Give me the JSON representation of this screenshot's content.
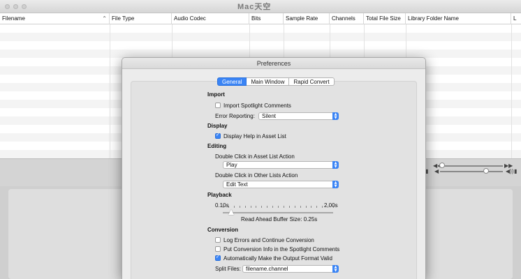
{
  "watermark": "Mac天空",
  "table": {
    "columns": [
      {
        "label": "Filename"
      },
      {
        "label": "File Type"
      },
      {
        "label": "Audio Codec"
      },
      {
        "label": "Bits"
      },
      {
        "label": "Sample Rate"
      },
      {
        "label": "Channels"
      },
      {
        "label": "Total File Size"
      },
      {
        "label": "Library Folder Name"
      },
      {
        "label": "L"
      }
    ],
    "sort_icon": "chevron-up-icon"
  },
  "controls": {
    "rewind_icon": "rewind-icon",
    "forward_icon": "fast-forward-icon",
    "volume_icon": "volume-icon"
  },
  "preferences": {
    "title": "Preferences",
    "tabs": [
      {
        "label": "General",
        "active": true
      },
      {
        "label": "Main Window",
        "active": false
      },
      {
        "label": "Rapid Convert",
        "active": false
      }
    ],
    "import": {
      "heading": "Import",
      "spotlight_comments": {
        "label": "Import Spotlight Comments",
        "checked": false
      },
      "error_reporting": {
        "label": "Error Reporting:",
        "value": "Silent"
      }
    },
    "display": {
      "heading": "Display",
      "help": {
        "label": "Display Help in Asset List",
        "checked": true
      }
    },
    "editing": {
      "heading": "Editing",
      "asset_list_label": "Double Click in Asset List Action",
      "asset_list_value": "Play",
      "other_lists_label": "Double Click in Other Lists Action",
      "other_lists_value": "Edit Text"
    },
    "playback": {
      "heading": "Playback",
      "min_label": "0.10s",
      "max_label": "2.00s",
      "buffer_label": "Read Ahead Buffer Size: 0.25s",
      "buffer_value_s": 0.25,
      "min_s": 0.1,
      "max_s": 2.0
    },
    "conversion": {
      "heading": "Conversion",
      "log_errors": {
        "label": "Log Errors and Continue Conversion",
        "checked": false
      },
      "put_info": {
        "label": "Put Conversion Info in the Spotlight Comments",
        "checked": false
      },
      "auto_valid": {
        "label": "Automatically Make the Output Format Valid",
        "checked": true
      },
      "split_files": {
        "label": "Split Files:",
        "value": "filename.channel"
      }
    }
  }
}
